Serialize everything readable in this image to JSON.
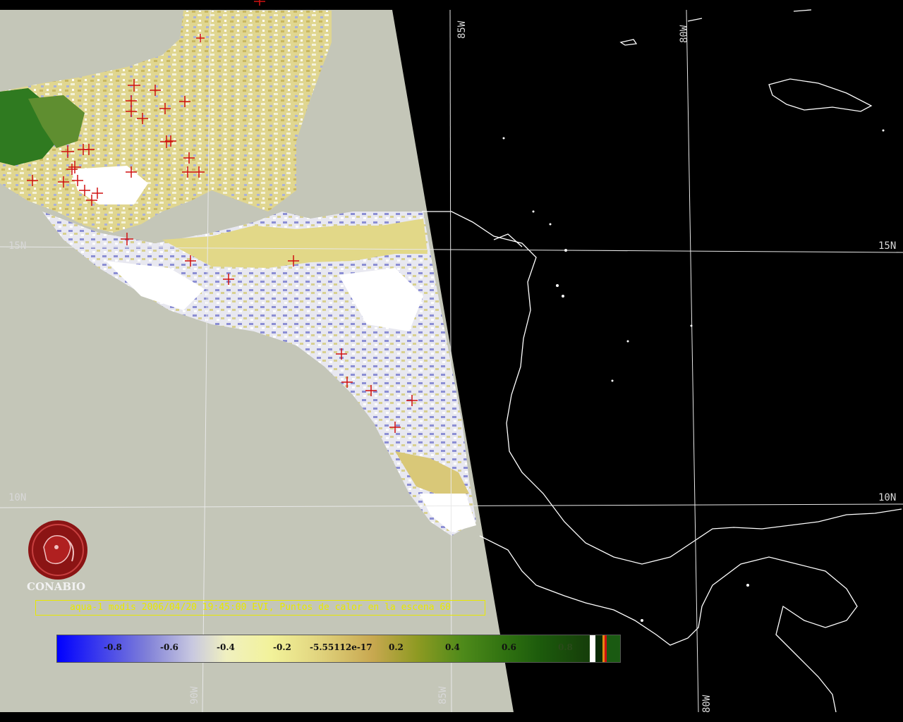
{
  "map": {
    "caption": "aqua-1 modis 2006/04/20 19:45:00 EVI, Puntos de calor en la escena 60",
    "logo_text": "CONABIO",
    "lat_labels": {
      "n15": "15N",
      "n10": "10N"
    },
    "lon_labels": {
      "w85": "85W",
      "w80": "80W",
      "w90": "90W"
    },
    "colors": {
      "land_no_data": "#c4c6b8",
      "night_side": "#000000",
      "hotspot": "#d01010",
      "caption": "#e8e800",
      "logo": "#8b1414"
    },
    "colorbar": {
      "ticks": [
        "-0.8",
        "-0.6",
        "-0.4",
        "-0.2",
        "-5.55112e-17",
        "0.2",
        "0.4",
        "0.6",
        "0.8"
      ]
    }
  }
}
